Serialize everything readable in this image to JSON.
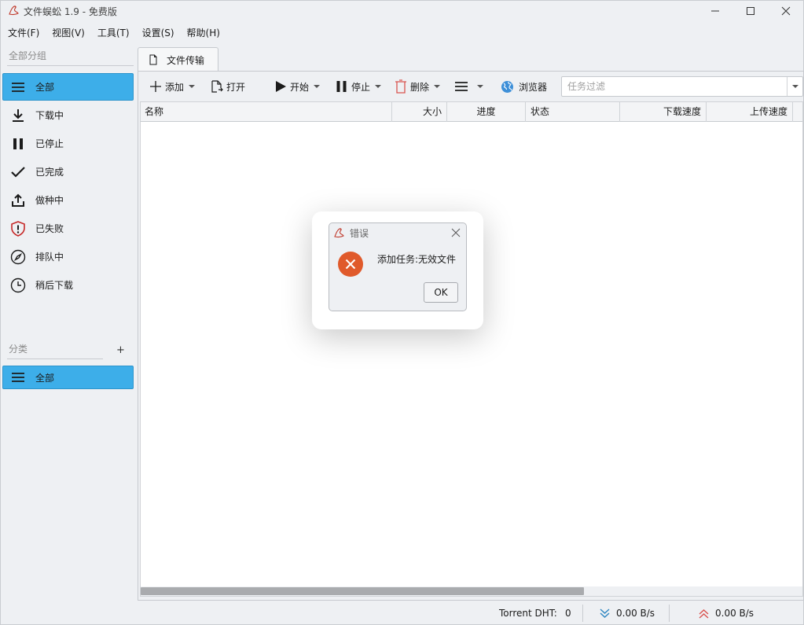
{
  "window": {
    "title": "文件蜈蚣 1.9 - 免费版"
  },
  "menu": [
    {
      "label": "文件(F)"
    },
    {
      "label": "视图(V)"
    },
    {
      "label": "工具(T)"
    },
    {
      "label": "设置(S)"
    },
    {
      "label": "帮助(H)"
    }
  ],
  "sidebar": {
    "groups_title": "全部分组",
    "groups": [
      {
        "label": "全部",
        "icon": "list-icon",
        "active": true
      },
      {
        "label": "下载中",
        "icon": "download-icon"
      },
      {
        "label": "已停止",
        "icon": "pause-icon"
      },
      {
        "label": "已完成",
        "icon": "check-icon"
      },
      {
        "label": "做种中",
        "icon": "upload-icon"
      },
      {
        "label": "已失败",
        "icon": "shield-alert-icon"
      },
      {
        "label": "排队中",
        "icon": "compass-icon"
      },
      {
        "label": "稍后下载",
        "icon": "clock-icon"
      }
    ],
    "category_title": "分类",
    "add_category": "+",
    "categories": [
      {
        "label": "全部",
        "icon": "list-icon",
        "active": true
      }
    ]
  },
  "tab": {
    "label": "文件传输"
  },
  "toolbar": {
    "add": "添加",
    "open": "打开",
    "start": "开始",
    "stop": "停止",
    "delete": "删除",
    "browser": "浏览器",
    "filter_placeholder": "任务过滤",
    "filter_value": ""
  },
  "table": {
    "columns": [
      "名称",
      "大小",
      "进度",
      "状态",
      "下载速度",
      "上传速度"
    ],
    "rows": [],
    "horizontal_scroll_fraction": 0.67
  },
  "status": {
    "dht_label": "Torrent DHT:",
    "dht_value": "0",
    "down_speed": "0.00 B/s",
    "up_speed": "0.00 B/s"
  },
  "dialog": {
    "title": "错误",
    "message": "添加任务:无效文件",
    "ok": "OK"
  },
  "colors": {
    "accent": "#3daee9",
    "error": "#e05a2b",
    "speed_down": "#2e86c1",
    "speed_up": "#d9534f"
  }
}
